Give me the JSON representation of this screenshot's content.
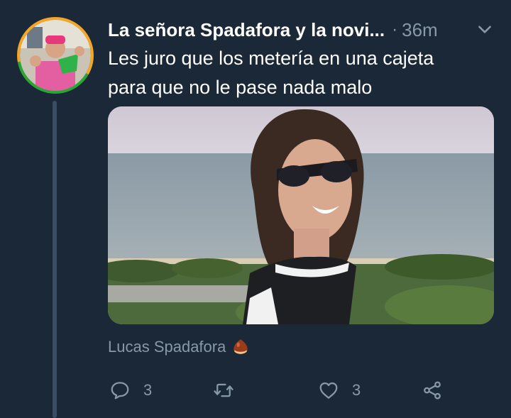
{
  "tweet": {
    "author_name": "La señora Spadafora y la novi...",
    "separator": "·",
    "timestamp": "36m",
    "text_line1": "Les juro que los metería en una cajeta",
    "text_line2": "para que no le pase nada malo",
    "media": {
      "caption": "Lucas Spadafora",
      "caption_icon": "chestnut-icon"
    },
    "actions": {
      "reply_count": "3",
      "retweet_count": "",
      "like_count": "3"
    }
  },
  "colors": {
    "background": "#1b2838",
    "secondary_text": "#8899a6",
    "thread_line": "#3b4d63",
    "avatar_ring_orange": "#f5a623",
    "avatar_ring_green": "#26a833"
  }
}
